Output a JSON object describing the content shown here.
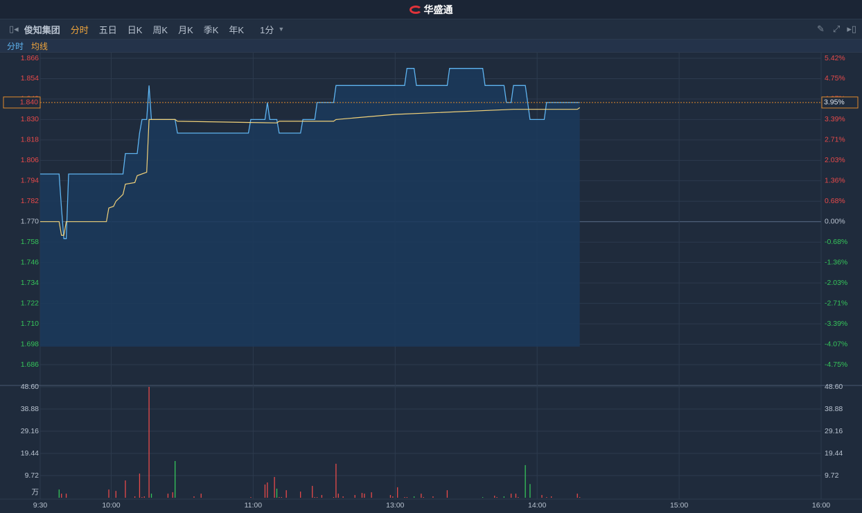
{
  "app": {
    "logo_text": "华盛通"
  },
  "toolbar": {
    "stock_name": "俊知集团",
    "tabs": [
      "分时",
      "五日",
      "日K",
      "周K",
      "月K",
      "季K",
      "年K"
    ],
    "active_tab": "分时",
    "interval": "1分"
  },
  "legend": {
    "price": "分时",
    "avg": "均线"
  },
  "colors": {
    "price_line": "#5fb4f0",
    "avg_line": "#f2d27a",
    "up": "#e84a4a",
    "down": "#35c45a",
    "neutral": "#b8c2cf",
    "grid": "#2d3b4e",
    "cursor": "#e08a2c"
  },
  "cursor": {
    "price_label": "1.840",
    "pct_label": "3.95%",
    "price": 1.84
  },
  "chart_data": {
    "type": "line",
    "prev_close": 1.77,
    "price_axis": [
      "1.866",
      "1.854",
      "1.842",
      "1.830",
      "1.818",
      "1.806",
      "1.794",
      "1.782",
      "1.770",
      "1.758",
      "1.746",
      "1.734",
      "1.722",
      "1.710",
      "1.698",
      "1.686"
    ],
    "pct_axis": [
      "5.42%",
      "4.75%",
      "4.07%",
      "3.39%",
      "2.71%",
      "2.03%",
      "1.36%",
      "0.68%",
      "0.00%",
      "-0.68%",
      "-1.36%",
      "-2.03%",
      "-2.71%",
      "-3.39%",
      "-4.07%",
      "-4.75%"
    ],
    "volume_axis": [
      "48.60",
      "38.88",
      "29.16",
      "19.44",
      "9.72"
    ],
    "volume_unit": "万",
    "volume_max": 48.6,
    "time_axis": [
      "9:30",
      "10:00",
      "11:00",
      "13:00",
      "14:00",
      "15:00",
      "16:00"
    ],
    "time_axis_minutes": [
      0,
      30,
      90,
      150,
      210,
      270,
      330
    ],
    "session_minutes": 330,
    "price": [
      [
        0,
        1.798
      ],
      [
        8,
        1.798
      ],
      [
        9,
        1.778
      ],
      [
        10,
        1.76
      ],
      [
        11,
        1.76
      ],
      [
        12,
        1.798
      ],
      [
        35,
        1.798
      ],
      [
        36,
        1.81
      ],
      [
        41,
        1.81
      ],
      [
        42,
        1.822
      ],
      [
        43,
        1.83
      ],
      [
        45,
        1.83
      ],
      [
        46,
        1.85
      ],
      [
        47,
        1.83
      ],
      [
        57,
        1.83
      ],
      [
        58,
        1.822
      ],
      [
        88,
        1.822
      ],
      [
        89,
        1.83
      ],
      [
        95,
        1.83
      ],
      [
        96,
        1.84
      ],
      [
        97,
        1.83
      ],
      [
        100,
        1.83
      ],
      [
        101,
        1.822
      ],
      [
        110,
        1.822
      ],
      [
        111,
        1.83
      ],
      [
        116,
        1.83
      ],
      [
        117,
        1.84
      ],
      [
        124,
        1.84
      ],
      [
        125,
        1.85
      ],
      [
        154,
        1.85
      ],
      [
        155,
        1.86
      ],
      [
        158,
        1.86
      ],
      [
        159,
        1.85
      ],
      [
        172,
        1.85
      ],
      [
        173,
        1.86
      ],
      [
        187,
        1.86
      ],
      [
        188,
        1.85
      ],
      [
        196,
        1.85
      ],
      [
        197,
        1.84
      ],
      [
        199,
        1.84
      ],
      [
        200,
        1.85
      ],
      [
        205,
        1.85
      ],
      [
        206,
        1.84
      ],
      [
        207,
        1.83
      ],
      [
        213,
        1.83
      ],
      [
        214,
        1.84
      ],
      [
        228,
        1.84
      ]
    ],
    "avg": [
      [
        0,
        1.77
      ],
      [
        8,
        1.77
      ],
      [
        9,
        1.762
      ],
      [
        10,
        1.762
      ],
      [
        11,
        1.77
      ],
      [
        28,
        1.77
      ],
      [
        29,
        1.778
      ],
      [
        31,
        1.779
      ],
      [
        32,
        1.782
      ],
      [
        35,
        1.786
      ],
      [
        36,
        1.792
      ],
      [
        40,
        1.793
      ],
      [
        41,
        1.797
      ],
      [
        45,
        1.799
      ],
      [
        46,
        1.83
      ],
      [
        57,
        1.83
      ],
      [
        58,
        1.829
      ],
      [
        100,
        1.828
      ],
      [
        101,
        1.829
      ],
      [
        124,
        1.829
      ],
      [
        125,
        1.83
      ],
      [
        150,
        1.833
      ],
      [
        200,
        1.836
      ],
      [
        227,
        1.836
      ],
      [
        228,
        1.837
      ]
    ],
    "volume": [
      [
        8,
        3.6,
        "down"
      ],
      [
        9,
        1.8,
        "up"
      ],
      [
        11,
        1.8,
        "up"
      ],
      [
        29,
        3.6,
        "up"
      ],
      [
        32,
        3.0,
        "up"
      ],
      [
        36,
        7.6,
        "up"
      ],
      [
        40,
        0.6,
        "up"
      ],
      [
        42,
        10.6,
        "up"
      ],
      [
        43,
        0.3,
        "up"
      ],
      [
        44,
        0.6,
        "up"
      ],
      [
        46,
        48.6,
        "up"
      ],
      [
        47,
        1.8,
        "down"
      ],
      [
        54,
        1.8,
        "up"
      ],
      [
        56,
        2.4,
        "up"
      ],
      [
        57,
        16.1,
        "down"
      ],
      [
        65,
        0.6,
        "up"
      ],
      [
        68,
        1.8,
        "up"
      ],
      [
        89,
        0.3,
        "up"
      ],
      [
        95,
        5.8,
        "up"
      ],
      [
        96,
        6.7,
        "up"
      ],
      [
        99,
        9.1,
        "up"
      ],
      [
        100,
        4.0,
        "down"
      ],
      [
        101,
        0.3,
        "up"
      ],
      [
        102,
        0.3,
        "up"
      ],
      [
        104,
        3.3,
        "up"
      ],
      [
        110,
        2.7,
        "up"
      ],
      [
        115,
        5.2,
        "up"
      ],
      [
        116,
        0.3,
        "up"
      ],
      [
        117,
        0.3,
        "up"
      ],
      [
        119,
        1.2,
        "up"
      ],
      [
        124,
        0.3,
        "up"
      ],
      [
        125,
        14.9,
        "up"
      ],
      [
        126,
        1.8,
        "up"
      ],
      [
        128,
        0.6,
        "up"
      ],
      [
        133,
        1.2,
        "up"
      ],
      [
        136,
        2.1,
        "up"
      ],
      [
        137,
        1.8,
        "up"
      ],
      [
        140,
        2.4,
        "up"
      ],
      [
        148,
        1.2,
        "up"
      ],
      [
        149,
        0.6,
        "up"
      ],
      [
        151,
        4.6,
        "up"
      ],
      [
        154,
        0.3,
        "up"
      ],
      [
        155,
        0.3,
        "up"
      ],
      [
        158,
        0.6,
        "down"
      ],
      [
        161,
        1.8,
        "up"
      ],
      [
        162,
        0.3,
        "up"
      ],
      [
        166,
        0.6,
        "up"
      ],
      [
        172,
        3.3,
        "up"
      ],
      [
        187,
        0.3,
        "down"
      ],
      [
        192,
        0.9,
        "up"
      ],
      [
        193,
        0.3,
        "up"
      ],
      [
        196,
        0.6,
        "down"
      ],
      [
        199,
        1.8,
        "up"
      ],
      [
        201,
        1.8,
        "up"
      ],
      [
        202,
        0.3,
        "up"
      ],
      [
        205,
        14.3,
        "down"
      ],
      [
        207,
        6.0,
        "down"
      ],
      [
        212,
        1.2,
        "up"
      ],
      [
        214,
        0.3,
        "up"
      ],
      [
        216,
        0.6,
        "up"
      ],
      [
        227,
        1.8,
        "up"
      ],
      [
        228,
        0.3,
        "up"
      ]
    ]
  }
}
